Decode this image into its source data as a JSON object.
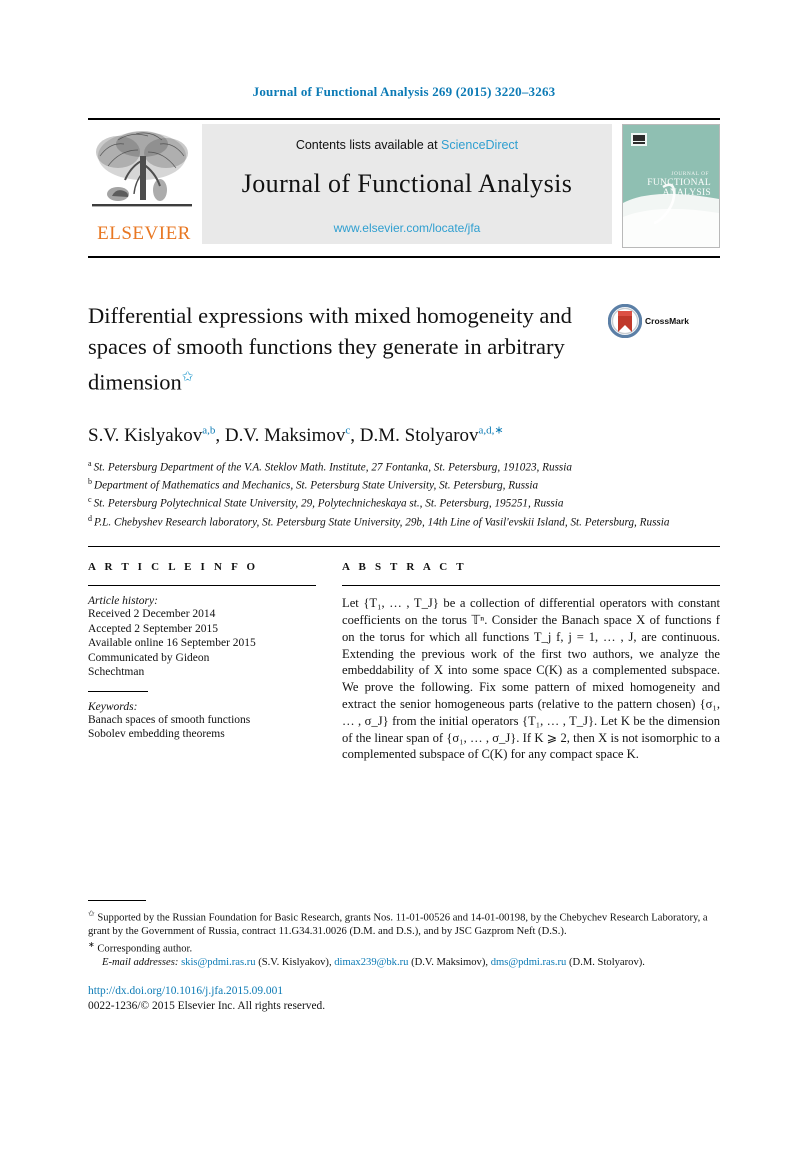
{
  "running_head": "Journal of Functional Analysis 269 (2015) 3220–3263",
  "masthead": {
    "publisher_wordmark": "ELSEVIER",
    "contents_prefix": "Contents lists available at ",
    "contents_link": "ScienceDirect",
    "journal_name": "Journal of Functional Analysis",
    "journal_url": "www.elsevier.com/locate/jfa",
    "cover_line1": "JOURNAL OF",
    "cover_line2": "FUNCTIONAL",
    "cover_line3": "ANALYSIS"
  },
  "article": {
    "title": "Differential expressions with mixed homogeneity and spaces of smooth functions they generate in arbitrary dimension",
    "title_footnote_mark": "✩",
    "crossmark_label": "CrossMark",
    "authors": [
      {
        "name": "S.V. Kislyakov",
        "marks": "a,b",
        "sep": ", "
      },
      {
        "name": "D.V. Maksimov",
        "marks": "c",
        "sep": ", "
      },
      {
        "name": "D.M. Stolyarov",
        "marks": "a,d,∗",
        "sep": ""
      }
    ],
    "affiliations": [
      {
        "mark": "a",
        "text": "St. Petersburg Department of the V.A. Steklov Math. Institute, 27 Fontanka, St. Petersburg, 191023, Russia"
      },
      {
        "mark": "b",
        "text": "Department of Mathematics and Mechanics, St. Petersburg State University, St. Petersburg, Russia"
      },
      {
        "mark": "c",
        "text": "St. Petersburg Polytechnical State University, 29, Polytechnicheskaya st., St. Petersburg, 195251, Russia"
      },
      {
        "mark": "d",
        "text": "P.L. Chebyshev Research laboratory, St. Petersburg State University, 29b, 14th Line of Vasil'evskii Island, St. Petersburg, Russia"
      }
    ]
  },
  "article_info": {
    "heading": "A R T I C L E   I N F O",
    "history_label": "Article history:",
    "history": [
      "Received 2 December 2014",
      "Accepted 2 September 2015",
      "Available online 16 September 2015",
      "Communicated by Gideon",
      "Schechtman"
    ],
    "keywords_label": "Keywords:",
    "keywords": [
      "Banach spaces of smooth functions",
      "Sobolev embedding theorems"
    ]
  },
  "abstract": {
    "heading": "A B S T R A C T",
    "text": "Let {T₁, … , T_J} be a collection of differential operators with constant coefficients on the torus 𝕋ⁿ. Consider the Banach space X of functions f on the torus for which all functions T_j f, j = 1, … , J, are continuous. Extending the previous work of the first two authors, we analyze the embeddability of X into some space C(K) as a complemented subspace. We prove the following. Fix some pattern of mixed homogeneity and extract the senior homogeneous parts (relative to the pattern chosen) {σ₁, … , σ_J} from the initial operators {T₁, … , T_J}. Let K be the dimension of the linear span of {σ₁, … , σ_J}. If K ⩾ 2, then X is not isomorphic to a complemented subspace of C(K) for any compact space K."
  },
  "footnotes": {
    "funding_mark": "✩",
    "funding": "Supported by the Russian Foundation for Basic Research, grants Nos. 11-01-00526 and 14-01-00198, by the Chebychev Research Laboratory, a grant by the Government of Russia, contract 11.G34.31.0026 (D.M. and D.S.), and by JSC Gazprom Neft (D.S.).",
    "corresponding_mark": "∗",
    "corresponding": "Corresponding author.",
    "email_label": "E-mail addresses:",
    "emails": [
      {
        "address": "skis@pdmi.ras.ru",
        "owner": "(S.V. Kislyakov)",
        "sep": ", "
      },
      {
        "address": "dimax239@bk.ru",
        "owner": "(D.V. Maksimov)",
        "sep": ","
      },
      {
        "address": "dms@pdmi.ras.ru",
        "owner": "(D.M. Stolyarov).",
        "sep": ""
      }
    ],
    "doi": "http://dx.doi.org/10.1016/j.jfa.2015.09.001",
    "copyright": "0022-1236/© 2015 Elsevier Inc. All rights reserved."
  },
  "colors": {
    "link": "#0b7ab5",
    "sciencedirect": "#2f9fd0",
    "elsevier_orange": "#E87722",
    "cover_green": "#8fbfb2"
  }
}
